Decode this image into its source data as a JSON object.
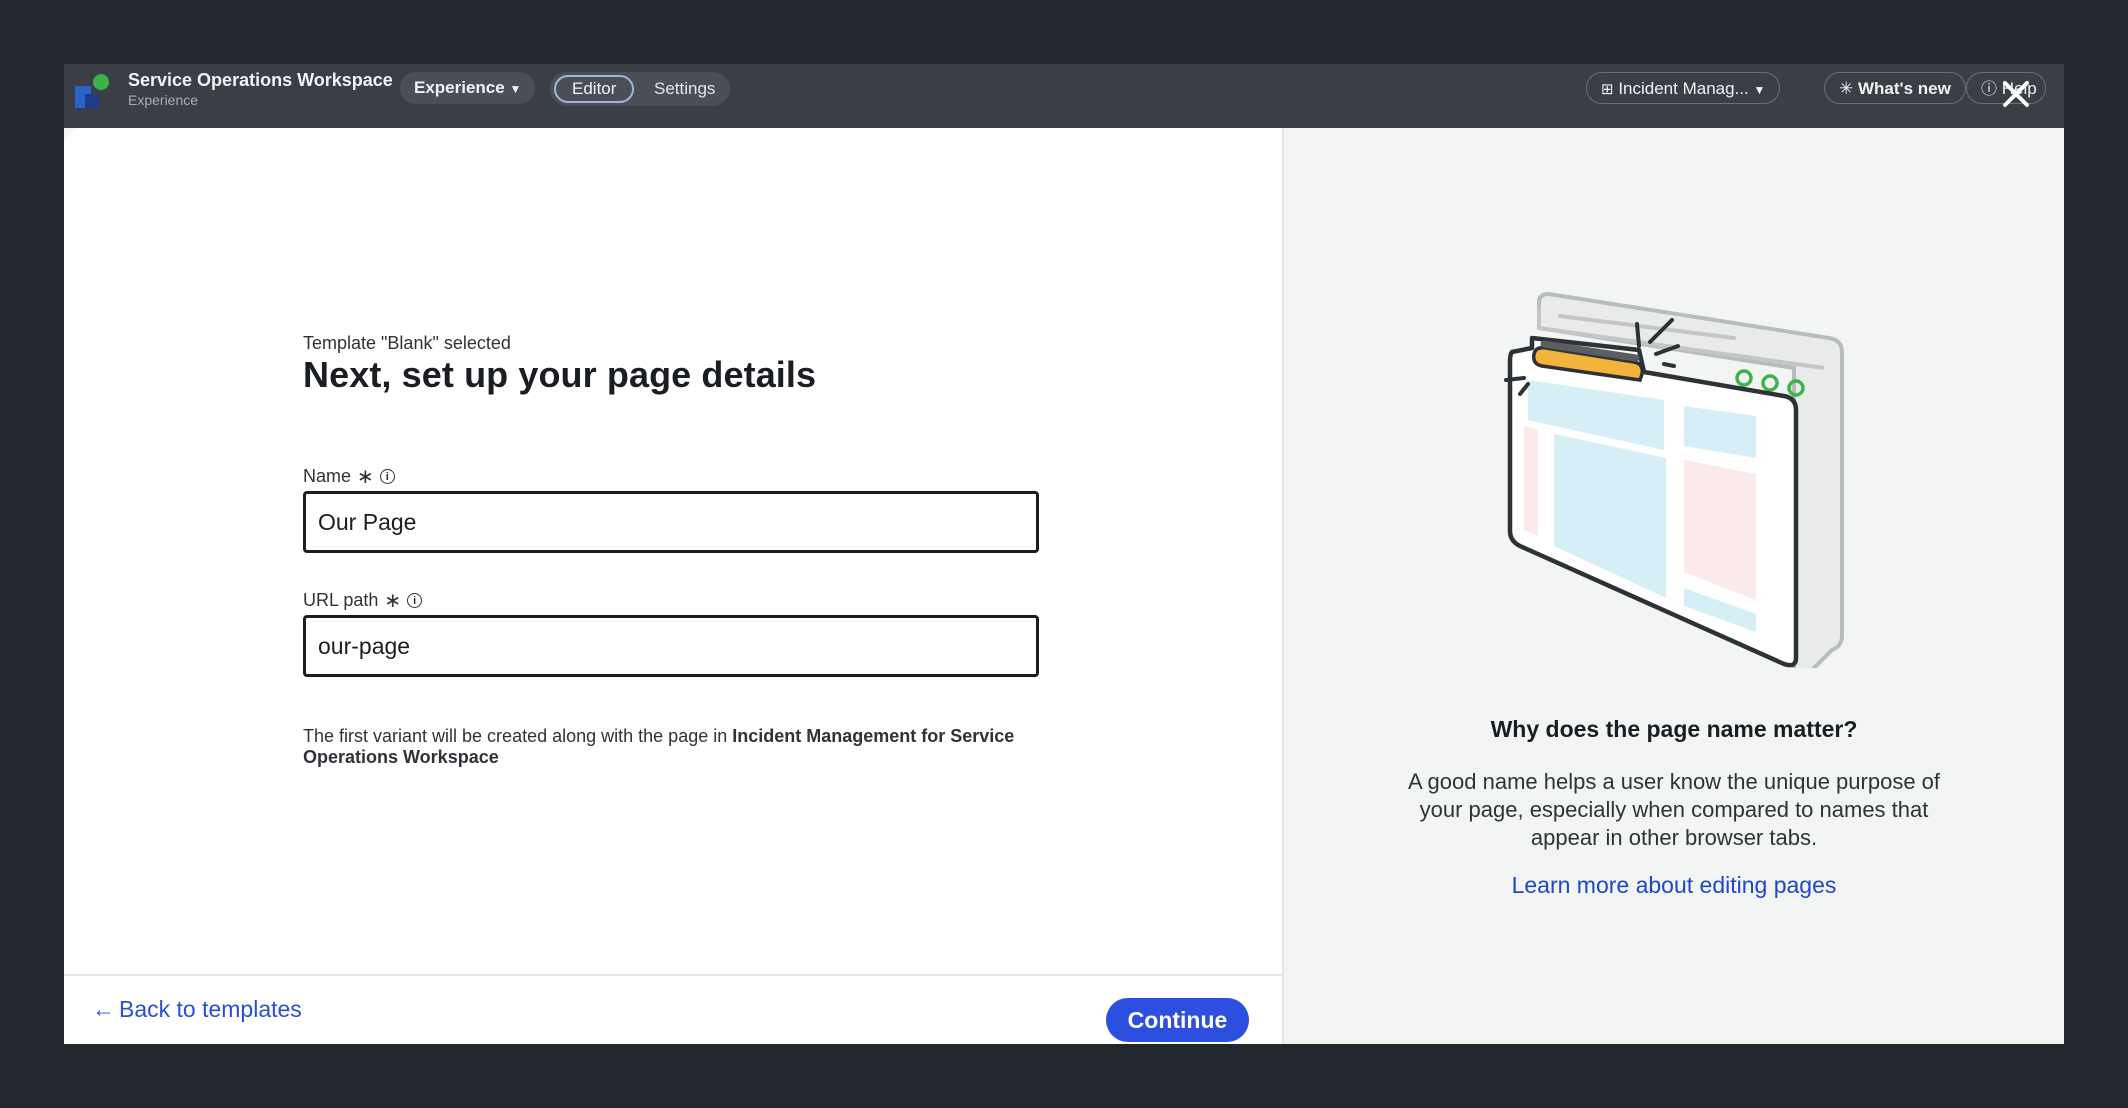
{
  "app": {
    "title": "Service Operations Workspace",
    "subtitle": "Experience",
    "experience_menu": "Experience",
    "tabs": [
      {
        "label": "Editor",
        "selected": true
      },
      {
        "label": "Settings",
        "selected": false
      }
    ],
    "incident_selector": "Incident Manag...",
    "whats_new": "What's new",
    "help": "Help"
  },
  "modal": {
    "eyebrow": "Template \"Blank\" selected",
    "heading": "Next, set up your page details",
    "name_field": {
      "label": "Name",
      "required_mark": "∗",
      "value": "Our Page"
    },
    "url_field": {
      "label": "URL path",
      "required_mark": "∗",
      "value": "our-page"
    },
    "variant_note": {
      "prefix": "The first variant will be created along with the page in ",
      "bold": "Incident Management for Service Operations Workspace"
    },
    "footer": {
      "back_label": "Back to templates",
      "continue_label": "Continue"
    },
    "aside": {
      "title": "Why does the page name matter?",
      "body": "A good name helps a user know the unique purpose of your page, especially when compared to names that appear in other browser tabs.",
      "link": "Learn more about editing pages"
    }
  },
  "colors": {
    "primary": "#2d4fe0",
    "link": "#1f46c7",
    "backdrop": "#22272e"
  }
}
